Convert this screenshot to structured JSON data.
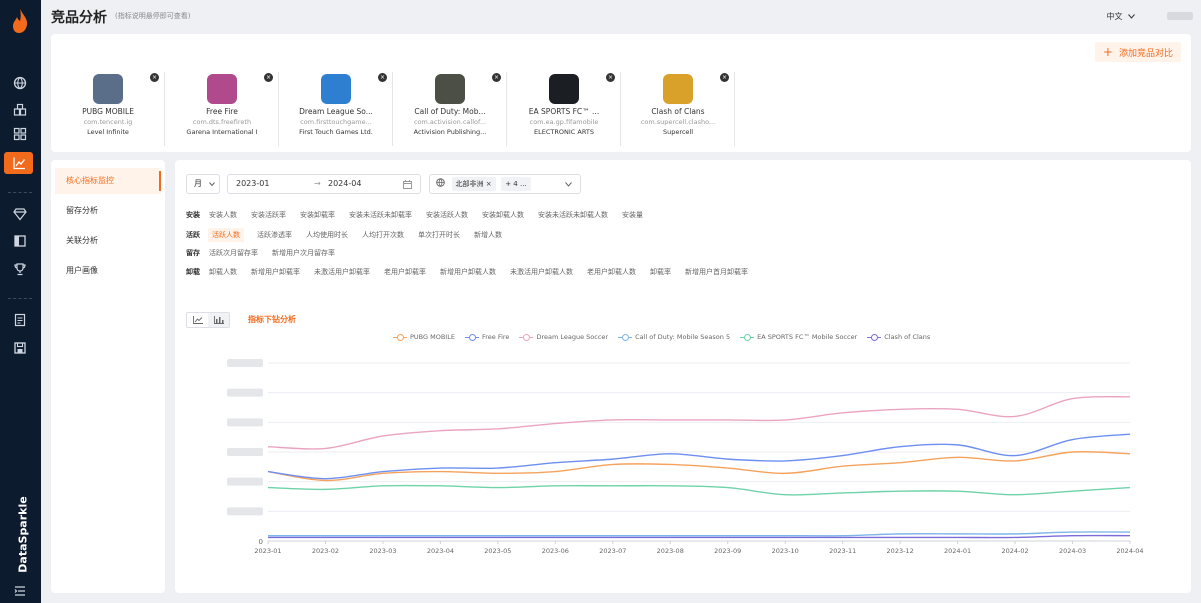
{
  "header": {
    "title": "竞品分析",
    "hint": "(指标说明悬停即可查看)",
    "language": "中文"
  },
  "nav": {
    "brand": "DataSparkle",
    "icons": [
      "logo-icon",
      "globe-icon",
      "apps-icon",
      "grid-icon",
      "chart-icon",
      "diamond-icon",
      "book-icon",
      "trophy-icon",
      "report-icon",
      "save-icon",
      "list-icon"
    ],
    "active": "chart-icon",
    "accent": "#f26b1d",
    "background": "#0d1b2e"
  },
  "compare": {
    "add_button": "添加竞品对比",
    "apps": [
      {
        "name": "PUBG MOBILE",
        "package": "com.tencent.ig",
        "publisher": "Level Infinite",
        "color": "#5a6e8a"
      },
      {
        "name": "Free Fire",
        "package": "com.dts.freefireth",
        "publisher": "Garena International I",
        "color": "#b04a8c"
      },
      {
        "name": "Dream League So...",
        "package": "com.firsttouchgame...",
        "publisher": "First Touch Games Ltd.",
        "color": "#2f7fd1"
      },
      {
        "name": "Call of Duty: Mob...",
        "package": "com.activision.callof...",
        "publisher": "Activision Publishing...",
        "color": "#4b4f46"
      },
      {
        "name": "EA SPORTS FC™ ...",
        "package": "com.ea.gp.fifamobile",
        "publisher": "ELECTRONIC ARTS",
        "color": "#1b1f24"
      },
      {
        "name": "Clash of Clans",
        "package": "com.supercell.clasho...",
        "publisher": "Supercell",
        "color": "#d9a02a"
      }
    ]
  },
  "menu": {
    "items": [
      "核心指标监控",
      "留存分析",
      "关联分析",
      "用户画像"
    ],
    "active": "核心指标监控"
  },
  "filters": {
    "granularity": "月",
    "date_start": "2023-01",
    "date_end": "2024-04",
    "region_chip": "北部非洲",
    "more_chip": "+ 4 ..."
  },
  "metrics": [
    {
      "category": "安装",
      "items": [
        "安装人数",
        "安装活跃率",
        "安装卸载率",
        "安装未活跃未卸载率",
        "安装活跃人数",
        "安装卸载人数",
        "安装未活跃未卸载人数",
        "安装量"
      ]
    },
    {
      "category": "活跃",
      "items": [
        "活跃人数",
        "活跃渗透率",
        "人均使用时长",
        "人均打开次数",
        "单次打开时长",
        "新增人数"
      ]
    },
    {
      "category": "留存",
      "items": [
        "活跃次月留存率",
        "新增用户次月留存率"
      ]
    },
    {
      "category": "卸载",
      "items": [
        "卸载人数",
        "新增用户卸载率",
        "未激活用户卸载率",
        "老用户卸载率",
        "新增用户卸载人数",
        "未激活用户卸载人数",
        "老用户卸载人数",
        "卸载率",
        "新增用户首月卸载率"
      ]
    }
  ],
  "selected_metric": "活跃人数",
  "drilldown_label": "指标下钻分析",
  "chart_data": {
    "type": "line",
    "x": [
      "2023-01",
      "2023-02",
      "2023-03",
      "2023-04",
      "2023-05",
      "2023-06",
      "2023-07",
      "2023-08",
      "2023-09",
      "2023-10",
      "2023-11",
      "2023-12",
      "2024-01",
      "2024-02",
      "2024-03",
      "2024-04"
    ],
    "ylim": [
      0,
      100
    ],
    "y_zero_label": "0",
    "y_tick_labels_blurred": true,
    "grid": "horizontal",
    "legend_position": "top",
    "series": [
      {
        "name": "PUBG MOBILE",
        "color": "#f5a25d",
        "values": [
          39,
          34,
          38,
          39,
          38,
          39,
          43,
          43,
          41,
          38,
          42,
          44,
          47,
          45,
          50,
          49
        ]
      },
      {
        "name": "Free Fire",
        "color": "#6d8ff0",
        "values": [
          39,
          35,
          39,
          41,
          41,
          44,
          46,
          49,
          46,
          45,
          48,
          53,
          54,
          48,
          57,
          60
        ]
      },
      {
        "name": "Dream League Soccer",
        "color": "#eba4c0",
        "values": [
          53,
          52,
          59,
          62,
          63,
          66,
          68,
          68,
          68,
          68,
          72,
          74,
          74,
          70,
          80,
          81
        ]
      },
      {
        "name": "Call of Duty: Mobile Season 5",
        "color": "#7fb6ea",
        "values": [
          3,
          3,
          3,
          3,
          3,
          3,
          3,
          3,
          3,
          3,
          3,
          4,
          4,
          4,
          5,
          5
        ]
      },
      {
        "name": "EA SPORTS FC™ Mobile Soccer",
        "color": "#6fd3a8",
        "values": [
          30,
          29,
          31,
          31,
          30,
          31,
          31,
          31,
          30,
          26,
          27,
          28,
          28,
          26,
          28,
          30
        ]
      },
      {
        "name": "Clash of Clans",
        "color": "#7a6cd8",
        "values": [
          2,
          2,
          2,
          2,
          2,
          2,
          2,
          2,
          2,
          2,
          2,
          2,
          2,
          2,
          3,
          3
        ]
      }
    ]
  }
}
